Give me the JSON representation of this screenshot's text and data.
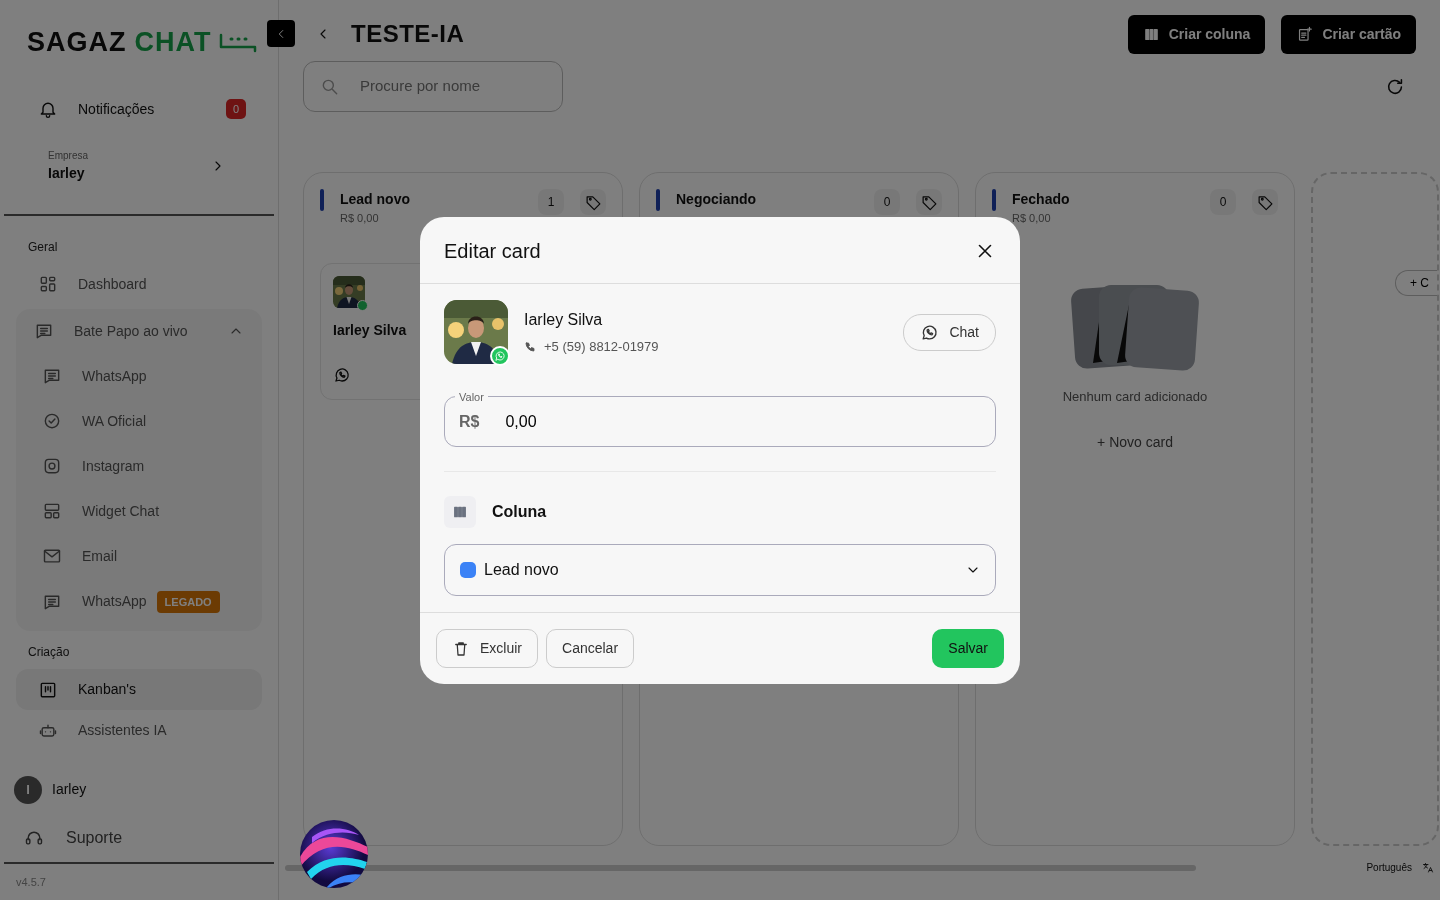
{
  "brand": {
    "first": "SAGAZ",
    "second": "CHAT"
  },
  "sidebar": {
    "notifications": {
      "label": "Notificações",
      "count": "0"
    },
    "company": {
      "label": "Empresa",
      "name": "Iarley"
    },
    "sections": [
      {
        "title": "Geral",
        "items": [
          {
            "kind": "link",
            "label": "Dashboard",
            "selected": false
          },
          {
            "kind": "group",
            "label": "Bate Papo ao vivo",
            "expanded": true,
            "children": [
              {
                "label": "WhatsApp",
                "selected": false
              },
              {
                "label": "WA Oficial",
                "selected": false
              },
              {
                "label": "Instagram",
                "selected": false
              },
              {
                "label": "Widget Chat",
                "selected": false
              },
              {
                "label": "Email",
                "selected": false
              },
              {
                "label": "WhatsApp",
                "badge": "LEGADO",
                "selected": false
              }
            ]
          }
        ]
      },
      {
        "title": "Criação",
        "items": [
          {
            "kind": "link",
            "label": "Kanban's",
            "selected": true
          },
          {
            "kind": "link",
            "label": "Assistentes IA",
            "selected": false
          }
        ]
      }
    ],
    "user": {
      "initial": "I",
      "name": "Iarley"
    },
    "support": "Suporte",
    "version": "v4.5.7"
  },
  "header": {
    "title": "TESTE-IA",
    "buttons": [
      "Criar coluna",
      "Criar cartão"
    ],
    "search": {
      "placeholder": "Procure por nome"
    }
  },
  "board": {
    "columns": [
      {
        "title": "Lead novo",
        "total": "R$ 0,00",
        "count": "1",
        "cards": [
          {
            "name": "Iarley Silva"
          }
        ]
      },
      {
        "title": "Negociando",
        "count": "0"
      },
      {
        "title": "Fechado",
        "total": "R$ 0,00",
        "count": "0",
        "empty_text": "Nenhum card adicionado",
        "add_label": "+ Novo card"
      }
    ],
    "add_column": "+ C"
  },
  "modal": {
    "title": "Editar card",
    "contact": {
      "name": "Iarley Silva",
      "phone": "+5 (59) 8812-01979"
    },
    "chat_button": "Chat",
    "value_field": {
      "label": "Valor",
      "prefix": "R$",
      "value": "0,00"
    },
    "column_section": "Coluna",
    "column_select": {
      "value": "Lead novo",
      "color": "#3b82f6"
    },
    "buttons": {
      "delete": "Excluir",
      "cancel": "Cancelar",
      "save": "Salvar"
    }
  },
  "footer": {
    "language": "Português"
  }
}
